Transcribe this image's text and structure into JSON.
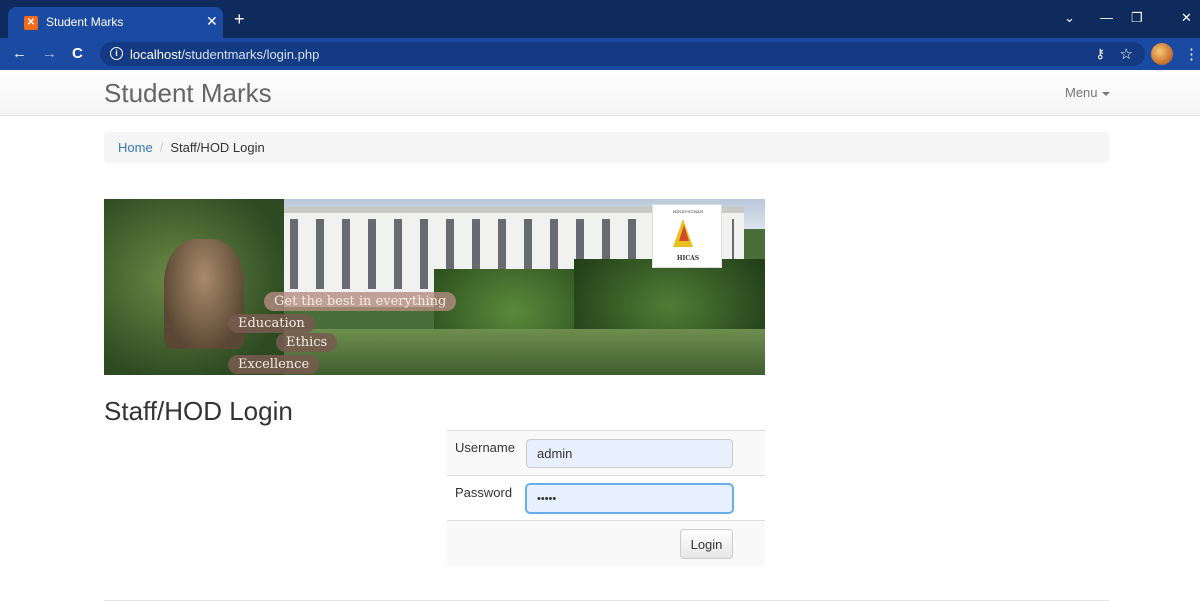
{
  "browser": {
    "tab_title": "Student Marks",
    "tab_favicon": "xampp-icon",
    "url_host": "localhost",
    "url_path": "/studentmarks/login.php"
  },
  "navbar": {
    "brand": "Student Marks",
    "menu_label": "Menu"
  },
  "breadcrumb": {
    "home": "Home",
    "separator": "/",
    "current": "Staff/HOD Login"
  },
  "banner": {
    "tagline": "Get the best in everything",
    "word1": "Education",
    "word2": "Ethics",
    "word3": "Excellence",
    "logo_text": "HICAS",
    "logo_top": "HINDUSTHAN"
  },
  "page": {
    "heading": "Staff/HOD Login"
  },
  "form": {
    "username_label": "Username",
    "username_value": "admin",
    "password_label": "Password",
    "password_value": "•••••",
    "login_button": "Login"
  }
}
